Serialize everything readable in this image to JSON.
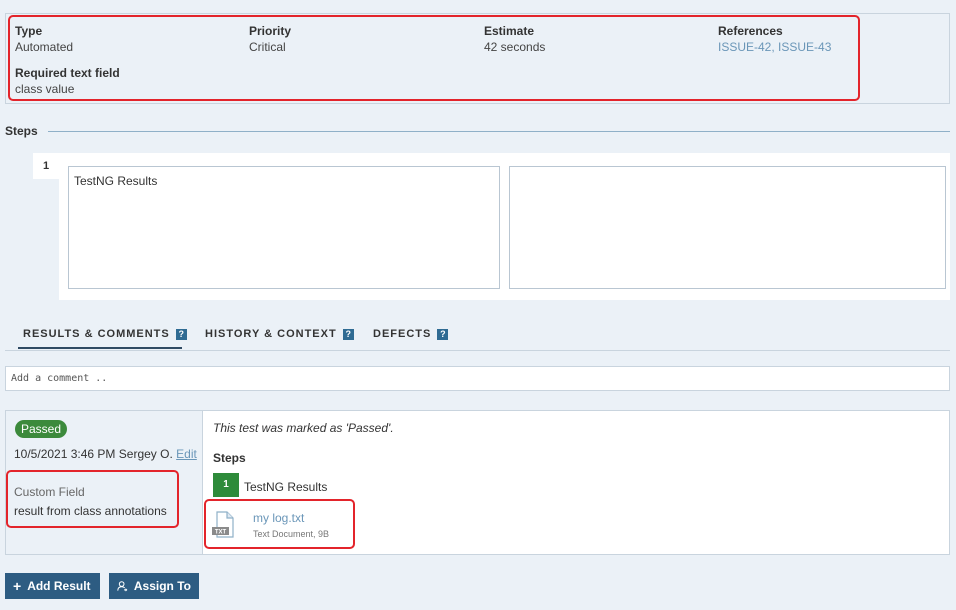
{
  "fields": [
    {
      "label": "Type",
      "value": "Automated"
    },
    {
      "label": "Priority",
      "value": "Critical"
    },
    {
      "label": "Estimate",
      "value": "42 seconds"
    },
    {
      "label": "References",
      "value": "ISSUE-42, ISSUE-43"
    },
    {
      "label": "Required text field",
      "value": "class value"
    }
  ],
  "steps": {
    "heading": "Steps",
    "items": [
      {
        "number": "1",
        "content": "TestNG Results",
        "expected": ""
      }
    ]
  },
  "tabs": [
    {
      "label": "RESULTS & COMMENTS",
      "help": "?"
    },
    {
      "label": "HISTORY & CONTEXT",
      "help": "?"
    },
    {
      "label": "DEFECTS",
      "help": "?"
    }
  ],
  "comment": {
    "placeholder": "Add a comment .."
  },
  "result": {
    "status": "Passed",
    "timestamp": "10/5/2021 3:46 PM",
    "user": "Sergey O.",
    "edit_label": "Edit",
    "custom_field_label": "Custom Field",
    "custom_field_value": "result from class annotations",
    "message": "This test was marked as 'Passed'.",
    "steps_heading": "Steps",
    "step_number": "1",
    "step_text": "TestNG Results",
    "attachment": {
      "name": "my log.txt",
      "meta": "Text Document, 9B",
      "icon_label": "TXT"
    }
  },
  "buttons": {
    "add_result": "Add Result",
    "assign_to": "Assign To"
  },
  "colors": {
    "accent": "#2d5c82",
    "passed": "#3c8a3c",
    "step_badge": "#2e8b3a",
    "link": "#6a96b8",
    "highlight": "#e3242b"
  }
}
